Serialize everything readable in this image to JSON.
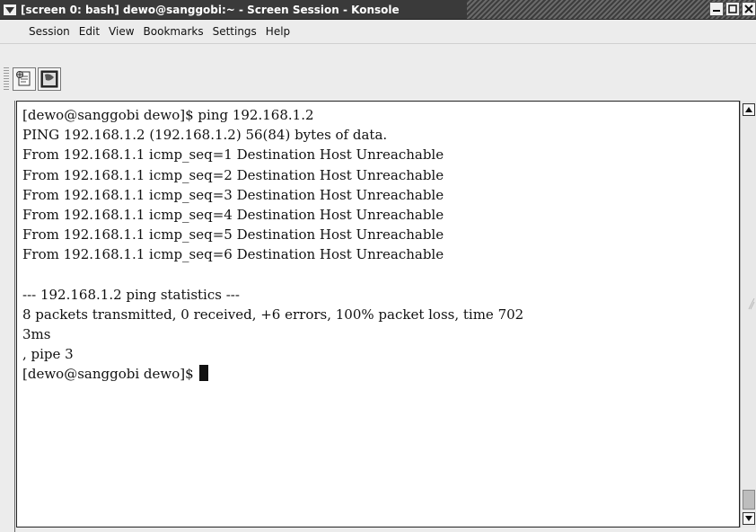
{
  "window": {
    "title": "[screen 0: bash] dewo@sanggobi:~ - Screen Session - Konsole"
  },
  "menubar": {
    "items": [
      "Session",
      "Edit",
      "View",
      "Bookmarks",
      "Settings",
      "Help"
    ]
  },
  "toolbar": {
    "buttons": [
      {
        "icon": "new-session-icon"
      },
      {
        "icon": "terminal-icon"
      }
    ]
  },
  "terminal": {
    "lines": [
      "[dewo@sanggobi dewo]$ ping 192.168.1.2",
      "PING 192.168.1.2 (192.168.1.2) 56(84) bytes of data.",
      "From 192.168.1.1 icmp_seq=1 Destination Host Unreachable",
      "From 192.168.1.1 icmp_seq=2 Destination Host Unreachable",
      "From 192.168.1.1 icmp_seq=3 Destination Host Unreachable",
      "From 192.168.1.1 icmp_seq=4 Destination Host Unreachable",
      "From 192.168.1.1 icmp_seq=5 Destination Host Unreachable",
      "From 192.168.1.1 icmp_seq=6 Destination Host Unreachable",
      "",
      "--- 192.168.1.2 ping statistics ---",
      "8 packets transmitted, 0 received, +6 errors, 100% packet loss, time 702",
      "3ms",
      ", pipe 3"
    ],
    "prompt": "[dewo@sanggobi dewo]$ "
  }
}
